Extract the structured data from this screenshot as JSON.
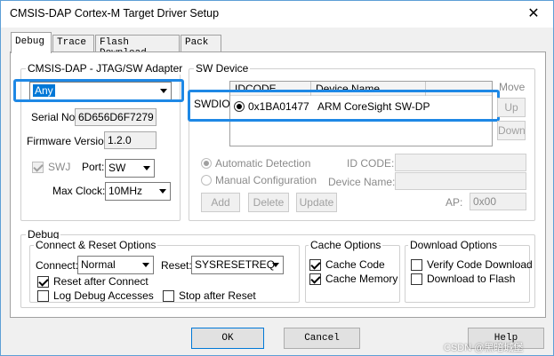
{
  "window": {
    "title": "CMSIS-DAP Cortex-M Target Driver Setup",
    "close_glyph": "✕"
  },
  "tabs": [
    {
      "label": "Debug"
    },
    {
      "label": "Trace"
    },
    {
      "label": "Flash Download"
    },
    {
      "label": "Pack"
    }
  ],
  "adapter": {
    "group_label": "CMSIS-DAP - JTAG/SW Adapter",
    "selected": "Any",
    "serial_label": "Serial No:",
    "serial_value": "6D656D6F7279",
    "firmware_label": "Firmware Version:",
    "firmware_value": "1.2.0",
    "swj_label": "SWJ",
    "swj_checked": true,
    "port_label": "Port:",
    "port_value": "SW",
    "maxclock_label": "Max Clock:",
    "maxclock_value": "10MHz"
  },
  "sw_device": {
    "group_label": "SW Device",
    "columns": [
      "IDCODE",
      "Device Name"
    ],
    "row_label": "SWDIO",
    "rows": [
      {
        "idcode": "0x1BA01477",
        "device_name": "ARM CoreSight SW-DP",
        "selected": true
      }
    ],
    "buttons": {
      "move": "Move",
      "up": "Up",
      "down": "Down"
    },
    "auto_detection_label": "Automatic Detection",
    "manual_config_label": "Manual Configuration",
    "id_code_label": "ID CODE:",
    "device_name_label": "Device Name:",
    "ap_label": "AP:",
    "ap_value": "0x00",
    "add_label": "Add",
    "delete_label": "Delete",
    "update_label": "Update"
  },
  "debug": {
    "group_label": "Debug",
    "connect_reset": {
      "group_label": "Connect & Reset Options",
      "connect_label": "Connect:",
      "connect_value": "Normal",
      "reset_label": "Reset:",
      "reset_value": "SYSRESETREQ",
      "reset_after_connect_label": "Reset after Connect",
      "reset_after_connect_checked": true,
      "log_debug_label": "Log Debug Accesses",
      "log_debug_checked": false,
      "stop_after_reset_label": "Stop after Reset",
      "stop_after_reset_checked": false
    },
    "cache": {
      "group_label": "Cache Options",
      "cache_code_label": "Cache Code",
      "cache_code_checked": true,
      "cache_memory_label": "Cache Memory",
      "cache_memory_checked": true
    },
    "download": {
      "group_label": "Download Options",
      "verify_label": "Verify Code Download",
      "verify_checked": false,
      "download_flash_label": "Download to Flash",
      "download_flash_checked": false
    }
  },
  "footer": {
    "ok_label": "OK",
    "cancel_label": "Cancel",
    "help_label": "Help"
  },
  "watermark": "CSDN @黑暗城堡",
  "colors": {
    "highlight": "#1e88e5",
    "selection": "#0078d7"
  }
}
